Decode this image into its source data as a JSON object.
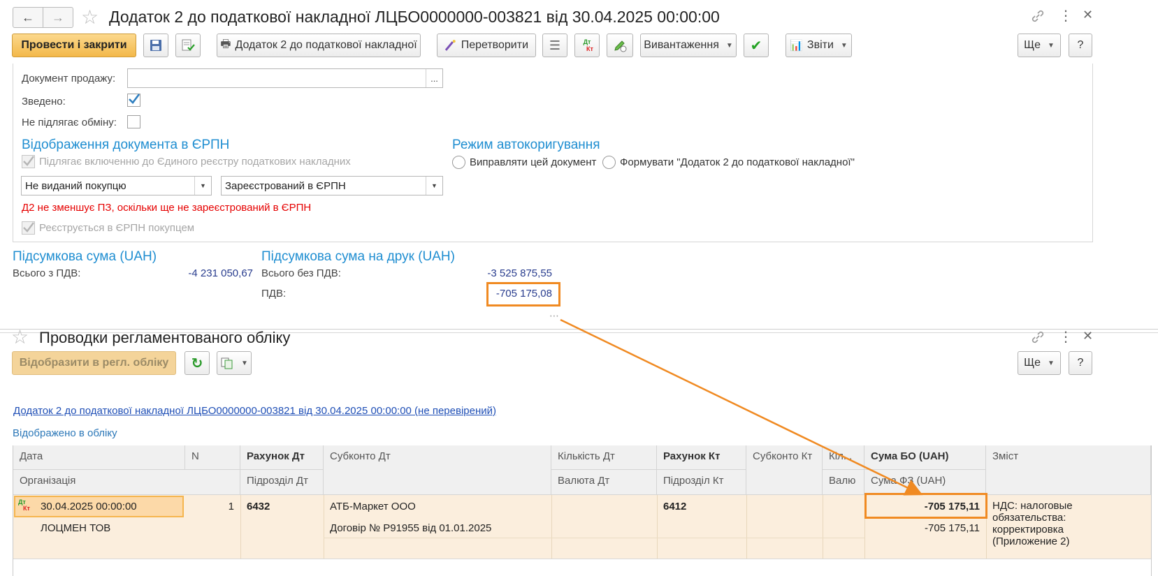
{
  "top": {
    "title": "Додаток 2 до податкової накладної ЛЦБО0000000-003821 від 30.04.2025 00:00:00",
    "toolbar": {
      "post_close": "Провести і закрити",
      "print_form": "Додаток 2 до податкової накладної",
      "convert": "Перетворити",
      "dt_kt": "Дт Кт",
      "export": "Вивантаження",
      "reports": "Звіти",
      "more": "Ще",
      "help": "?"
    },
    "form": {
      "sale_doc_label": "Документ продажу:",
      "sale_doc_value": "",
      "sale_doc_select": "...",
      "consolidated_label": "Зведено:",
      "not_exchanged_label": "Не підлягає обміну:",
      "erpn_title": "Відображення документа в ЄРПН",
      "erpn_include_label": "Підлягає включенню до Єдиного реєстру податкових накладних",
      "issued_value": "Не виданий покупцю",
      "registered_value": "Зареєстрований в ЄРПН",
      "warning": "Д2 не зменшує ПЗ, оскільки ще не зареєстрований в ЄРПН",
      "buyer_registers_label": "Реєструється в ЄРПН покупцем",
      "autocorr_title": "Режим автокоригування",
      "autocorr_opt1": "Виправляти цей документ",
      "autocorr_opt2": "Формувати \"Додаток 2 до податкової накладної\""
    },
    "totals": {
      "sum_title": "Підсумкова сума (UAH)",
      "total_vat_label": "Всього з ПДВ:",
      "total_vat_value": "-4 231 050,67",
      "print_title": "Підсумкова сума на друк (UAH)",
      "total_no_vat_label": "Всього без ПДВ:",
      "total_no_vat_value": "-3 525 875,55",
      "vat_label": "ПДВ:",
      "vat_value": "-705 175,08"
    }
  },
  "bottom": {
    "title": "Проводки регламентованого обліку",
    "toolbar": {
      "reflect": "Відобразити в регл. обліку",
      "more": "Ще",
      "help": "?"
    },
    "doc_link": "Додаток 2 до податкової накладної ЛЦБО0000000-003821 від 30.04.2025 00:00:00 (не перевірений)",
    "status": "Відображено в обліку",
    "table": {
      "headers": {
        "date": "Дата",
        "n": "N",
        "acct_dt": "Рахунок Дт",
        "subconto_dt": "Субконто Дт",
        "qty_dt": "Кількість Дт",
        "acct_kt": "Рахунок Кт",
        "subconto_kt": "Субконто Кт",
        "qty_kt": "Кіл...",
        "sum_bo": "Сума БО (UAH)",
        "content": "Зміст",
        "org": "Організація",
        "dept_dt": "Підрозділ Дт",
        "curr_dt": "Валюта Дт",
        "dept_kt": "Підрозділ Кт",
        "curr_kt": "Валю",
        "sum_fz": "Сума ФЗ (UAH)"
      },
      "row": {
        "icon": "Дт Кт",
        "date": "30.04.2025 00:00:00",
        "n": "1",
        "acct_dt": "6432",
        "subconto_dt_1": "АТБ-Маркет ООО",
        "subconto_dt_2": "Договір № Р91955 від 01.01.2025",
        "acct_kt": "6412",
        "org": "ЛОЦМЕН ТОВ",
        "sum_bo": "-705 175,11",
        "sum_fz": "-705 175,11",
        "content": "НДС: налоговые обязательства: корректировка (Приложение 2)"
      }
    }
  },
  "colors": {
    "accent_orange": "#f08a22",
    "section_blue": "#1f8ed1",
    "value_blue": "#283c8e",
    "negative_red": "#e60000"
  }
}
